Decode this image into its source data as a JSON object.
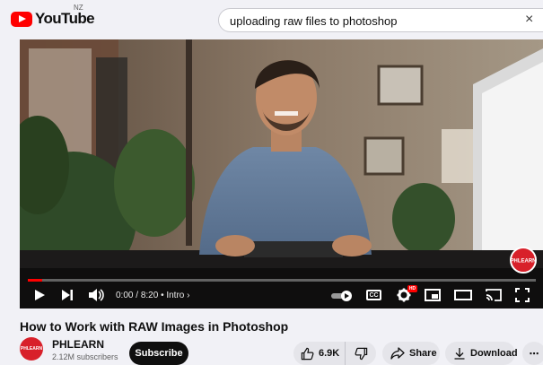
{
  "masthead": {
    "logo_text": "YouTube",
    "region": "NZ",
    "search_value": "uploading raw files to photoshop",
    "clear_glyph": "×"
  },
  "player": {
    "progress_fraction": 0.028,
    "current_time": "0:00",
    "duration": "8:20",
    "chapter": "Intro",
    "cc_label": "CC",
    "hd_label": "HD",
    "watermark_label": "PHLEARN"
  },
  "video": {
    "title": "How to Work with RAW Images in Photoshop"
  },
  "channel": {
    "avatar_text": "PHLEARN",
    "name": "PHLEARN",
    "subscribers": "2.12M subscribers",
    "subscribe_label": "Subscribe"
  },
  "actions": {
    "like_count": "6.9K",
    "share_label": "Share",
    "download_label": "Download",
    "more_glyph": "⋯"
  },
  "colors": {
    "accent": "#ff0000",
    "button_dark": "#0f0f0f",
    "pill_bg": "#e5e5ea"
  }
}
